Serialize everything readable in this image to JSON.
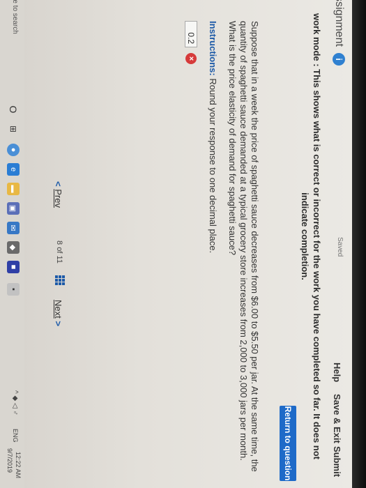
{
  "header": {
    "title": "ssignment",
    "info_icon": "i",
    "saved": "Saved",
    "help": "Help",
    "save_exit": "Save & Exit",
    "submit": "Submit"
  },
  "banner": {
    "text": "work mode : This shows what is correct or incorrect for the work you have completed so far. It does not indicate completion.",
    "return_button": "Return to question"
  },
  "question": {
    "text": "Suppose that in a week the price of spaghetti sauce decreases from $6.00 to $5.50 per jar. At the same time, the quantity of spaghetti sauce demanded at a typical grocery store increases from 2,000 to 3,000 jars per month. What is the price elasticity of demand for spaghetti sauce?",
    "instructions_label": "Instructions:",
    "instructions_text": "Round your response to one decimal place.",
    "answer_value": "0.2",
    "wrong_icon": "×"
  },
  "nav": {
    "prev_chevron": "<",
    "prev_label": "Prev",
    "current": "8",
    "of_label": "of",
    "total": "11",
    "next_label": "Next",
    "next_chevron": ">"
  },
  "taskbar": {
    "search_text": "re to search",
    "cortana_glyph": "O",
    "taskview_glyph": "⊞",
    "chrome_glyph": "●",
    "edge_glyph": "e",
    "explorer_glyph": "▬",
    "store_glyph": "▣",
    "mail_glyph": "✉",
    "photos_glyph": "◆",
    "app7_glyph": "■",
    "app8_glyph": "▪",
    "tray": "^ ◆ ◁ ♂",
    "lang": "ENG",
    "time": "12:22 AM",
    "date": "9/7/2019"
  },
  "colors": {
    "accent_blue": "#1e6ac8",
    "error_red": "#d63a3a",
    "info_blue": "#2f80d0"
  }
}
